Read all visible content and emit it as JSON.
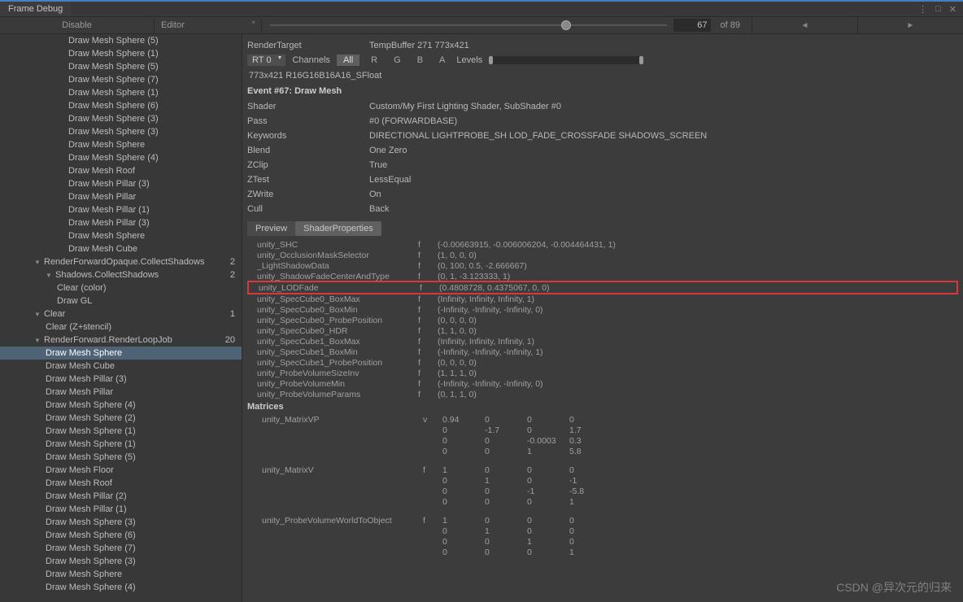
{
  "title": "Frame Debug",
  "toolbar": {
    "disable": "Disable",
    "mode": "Editor",
    "current": "67",
    "total": "of 89"
  },
  "tree": {
    "top": [
      {
        "label": "Draw Mesh Sphere (5)",
        "indent": 6
      },
      {
        "label": "Draw Mesh Sphere (1)",
        "indent": 6
      },
      {
        "label": "Draw Mesh Sphere (5)",
        "indent": 6
      },
      {
        "label": "Draw Mesh Sphere (7)",
        "indent": 6
      },
      {
        "label": "Draw Mesh Sphere (1)",
        "indent": 6
      },
      {
        "label": "Draw Mesh Sphere (6)",
        "indent": 6
      },
      {
        "label": "Draw Mesh Sphere (3)",
        "indent": 6
      },
      {
        "label": "Draw Mesh Sphere (3)",
        "indent": 6
      },
      {
        "label": "Draw Mesh Sphere",
        "indent": 6
      },
      {
        "label": "Draw Mesh Sphere (4)",
        "indent": 6
      },
      {
        "label": "Draw Mesh Roof",
        "indent": 6
      },
      {
        "label": "Draw Mesh Pillar (3)",
        "indent": 6
      },
      {
        "label": "Draw Mesh Pillar",
        "indent": 6
      },
      {
        "label": "Draw Mesh Pillar (1)",
        "indent": 6
      },
      {
        "label": "Draw Mesh Pillar (3)",
        "indent": 6
      },
      {
        "label": "Draw Mesh Sphere",
        "indent": 6
      },
      {
        "label": "Draw Mesh Cube",
        "indent": 6
      }
    ],
    "g1": {
      "label": "RenderForwardOpaque.CollectShadows",
      "count": "2",
      "fold": "▼",
      "indent": 3
    },
    "g1c": {
      "label": "Shadows.CollectShadows",
      "count": "2",
      "fold": "▼",
      "indent": 4
    },
    "g1i": [
      {
        "label": "Clear (color)",
        "indent": 5
      },
      {
        "label": "Draw GL",
        "indent": 5
      }
    ],
    "g2": {
      "label": "Clear",
      "count": "1",
      "fold": "▼",
      "indent": 3
    },
    "g2i": [
      {
        "label": "Clear (Z+stencil)",
        "indent": 4
      }
    ],
    "g3": {
      "label": "RenderForward.RenderLoopJob",
      "count": "20",
      "fold": "▼",
      "indent": 3
    },
    "g3i": [
      {
        "label": "Draw Mesh Sphere",
        "indent": 4,
        "selected": true
      },
      {
        "label": "Draw Mesh Cube",
        "indent": 4
      },
      {
        "label": "Draw Mesh Pillar (3)",
        "indent": 4
      },
      {
        "label": "Draw Mesh Pillar",
        "indent": 4
      },
      {
        "label": "Draw Mesh Sphere (4)",
        "indent": 4
      },
      {
        "label": "Draw Mesh Sphere (2)",
        "indent": 4
      },
      {
        "label": "Draw Mesh Sphere (1)",
        "indent": 4
      },
      {
        "label": "Draw Mesh Sphere (1)",
        "indent": 4
      },
      {
        "label": "Draw Mesh Sphere (5)",
        "indent": 4
      },
      {
        "label": "Draw Mesh Floor",
        "indent": 4
      },
      {
        "label": "Draw Mesh Roof",
        "indent": 4
      },
      {
        "label": "Draw Mesh Pillar (2)",
        "indent": 4
      },
      {
        "label": "Draw Mesh Pillar (1)",
        "indent": 4
      },
      {
        "label": "Draw Mesh Sphere (3)",
        "indent": 4
      },
      {
        "label": "Draw Mesh Sphere (6)",
        "indent": 4
      },
      {
        "label": "Draw Mesh Sphere (7)",
        "indent": 4
      },
      {
        "label": "Draw Mesh Sphere (3)",
        "indent": 4
      },
      {
        "label": "Draw Mesh Sphere",
        "indent": 4
      },
      {
        "label": "Draw Mesh Sphere (4)",
        "indent": 4
      }
    ]
  },
  "details": {
    "renderTargetLabel": "RenderTarget",
    "renderTarget": "TempBuffer 271 773x421",
    "rt": "RT 0",
    "channelsLabel": "Channels",
    "chAll": "All",
    "chR": "R",
    "chG": "G",
    "chB": "B",
    "chA": "A",
    "levelsLabel": "Levels",
    "format": "773x421 R16G16B16A16_SFloat",
    "event": "Event #67: Draw Mesh",
    "rows": [
      {
        "label": "Shader",
        "value": "Custom/My First Lighting Shader, SubShader #0"
      },
      {
        "label": "Pass",
        "value": "#0 (FORWARDBASE)"
      },
      {
        "label": "Keywords",
        "value": "DIRECTIONAL LIGHTPROBE_SH LOD_FADE_CROSSFADE SHADOWS_SCREEN"
      },
      {
        "label": "Blend",
        "value": "One Zero"
      },
      {
        "label": "ZClip",
        "value": "True"
      },
      {
        "label": "ZTest",
        "value": "LessEqual"
      },
      {
        "label": "ZWrite",
        "value": "On"
      },
      {
        "label": "Cull",
        "value": "Back"
      }
    ],
    "tabs": {
      "preview": "Preview",
      "shader": "ShaderProperties"
    },
    "props": [
      {
        "n": "unity_SHC",
        "t": "f",
        "v": "(-0.00663915, -0.006006204, -0.004464431, 1)"
      },
      {
        "n": "unity_OcclusionMaskSelector",
        "t": "f",
        "v": "(1, 0, 0, 0)"
      },
      {
        "n": "_LightShadowData",
        "t": "f",
        "v": "(0, 100, 0.5, -2.666667)"
      },
      {
        "n": "unity_ShadowFadeCenterAndType",
        "t": "f",
        "v": "(0, 1, -3.123333, 1)"
      },
      {
        "n": "unity_LODFade",
        "t": "f",
        "v": "(0.4808728, 0.4375067, 0, 0)",
        "hl": true
      },
      {
        "n": "unity_SpecCube0_BoxMax",
        "t": "f",
        "v": "(Infinity, Infinity, Infinity, 1)"
      },
      {
        "n": "unity_SpecCube0_BoxMin",
        "t": "f",
        "v": "(-Infinity, -Infinity, -Infinity, 0)"
      },
      {
        "n": "unity_SpecCube0_ProbePosition",
        "t": "f",
        "v": "(0, 0, 0, 0)"
      },
      {
        "n": "unity_SpecCube0_HDR",
        "t": "f",
        "v": "(1, 1, 0, 0)"
      },
      {
        "n": "unity_SpecCube1_BoxMax",
        "t": "f",
        "v": "(Infinity, Infinity, Infinity, 1)"
      },
      {
        "n": "unity_SpecCube1_BoxMin",
        "t": "f",
        "v": "(-Infinity, -Infinity, -Infinity, 1)"
      },
      {
        "n": "unity_SpecCube1_ProbePosition",
        "t": "f",
        "v": "(0, 0, 0, 0)"
      },
      {
        "n": "unity_ProbeVolumeSizeInv",
        "t": "f",
        "v": "(1, 1, 1, 0)"
      },
      {
        "n": "unity_ProbeVolumeMin",
        "t": "f",
        "v": "(-Infinity, -Infinity, -Infinity, 0)"
      },
      {
        "n": "unity_ProbeVolumeParams",
        "t": "f",
        "v": "(0, 1, 1, 0)"
      }
    ],
    "matricesLabel": "Matrices",
    "matrices": [
      {
        "n": "unity_MatrixVP",
        "t": "v",
        "rows": [
          [
            "0.94",
            "0",
            "0",
            "0"
          ],
          [
            "0",
            "-1.7",
            "0",
            "1.7"
          ],
          [
            "0",
            "0",
            "-0.0003",
            "0.3"
          ],
          [
            "0",
            "0",
            "1",
            "5.8"
          ]
        ]
      },
      {
        "n": "unity_MatrixV",
        "t": "f",
        "rows": [
          [
            "1",
            "0",
            "0",
            "0"
          ],
          [
            "0",
            "1",
            "0",
            "-1"
          ],
          [
            "0",
            "0",
            "-1",
            "-5.8"
          ],
          [
            "0",
            "0",
            "0",
            "1"
          ]
        ]
      },
      {
        "n": "unity_ProbeVolumeWorldToObject",
        "t": "f",
        "rows": [
          [
            "1",
            "0",
            "0",
            "0"
          ],
          [
            "0",
            "1",
            "0",
            "0"
          ],
          [
            "0",
            "0",
            "1",
            "0"
          ],
          [
            "0",
            "0",
            "0",
            "1"
          ]
        ]
      }
    ]
  },
  "watermark": "CSDN @异次元的归来"
}
